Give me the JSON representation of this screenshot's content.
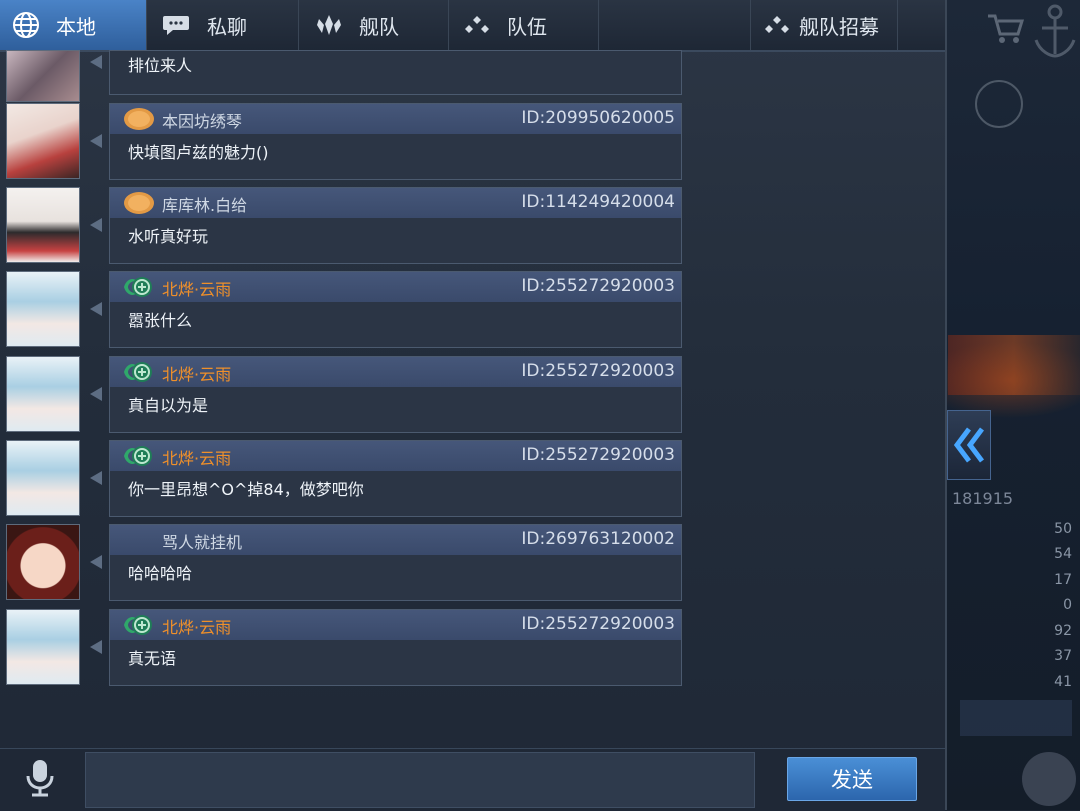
{
  "tabs": [
    {
      "label": "本地",
      "icon": "globe-icon",
      "active": true
    },
    {
      "label": "私聊",
      "icon": "chat-bubble-icon",
      "active": false
    },
    {
      "label": "舰队",
      "icon": "fleet-icon",
      "active": false
    },
    {
      "label": "队伍",
      "icon": "team-icon",
      "active": false
    },
    {
      "label": "舰队招募",
      "icon": "team-icon",
      "active": false
    }
  ],
  "messages": [
    {
      "text": "排位来人"
    },
    {
      "name": "本因坊绣琴",
      "id": "ID:209950620005",
      "text": "快填图卢兹的魅力()",
      "badge": "cookie"
    },
    {
      "name": "库库林.白给",
      "id": "ID:114249420004",
      "text": "水听真好玩",
      "badge": "cookie"
    },
    {
      "name": "北烨·云雨",
      "id": "ID:255272920003",
      "text": "嚣张什么",
      "badge": "emblem"
    },
    {
      "name": "北烨·云雨",
      "id": "ID:255272920003",
      "text": "真自以为是",
      "badge": "emblem"
    },
    {
      "name": "北烨·云雨",
      "id": "ID:255272920003",
      "text": "你一里昂想^O^掉84，做梦吧你",
      "badge": "emblem"
    },
    {
      "name": "骂人就挂机",
      "id": "ID:269763120002",
      "text": "哈哈哈哈",
      "badge": "none"
    },
    {
      "name": "北烨·云雨",
      "id": "ID:255272920003",
      "text": "真无语",
      "badge": "emblem"
    }
  ],
  "input": {
    "placeholder": ""
  },
  "send_label": "发送",
  "background": {
    "score": "181915",
    "stats": [
      "50",
      "54",
      "17",
      "0",
      "92",
      "37",
      "41"
    ]
  },
  "colors": {
    "accent": "#3b74bf",
    "vip_name": "#f0902a",
    "panel": "#232d3b"
  }
}
